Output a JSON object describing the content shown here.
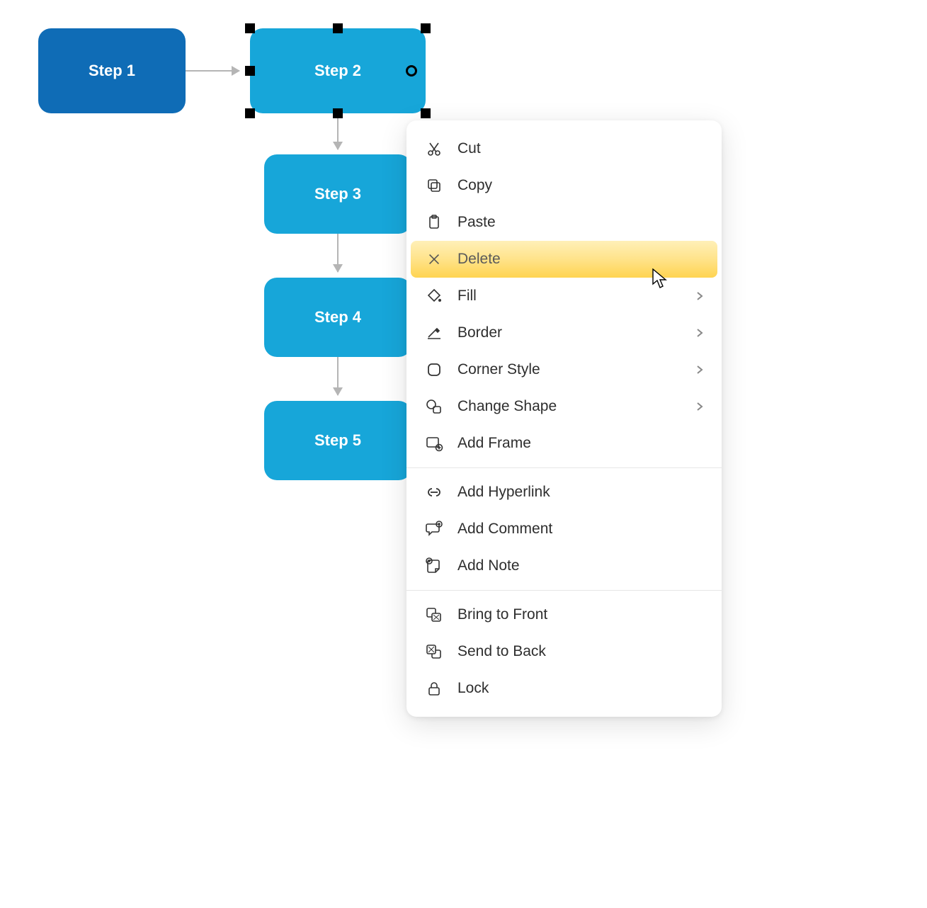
{
  "nodes": {
    "step1": "Step 1",
    "step2": "Step 2",
    "step3": "Step 3",
    "step4": "Step 4",
    "step5": "Step 5"
  },
  "selected_node": "step2",
  "context_menu": {
    "cut": "Cut",
    "copy": "Copy",
    "paste": "Paste",
    "delete": "Delete",
    "fill": "Fill",
    "border": "Border",
    "corner_style": "Corner Style",
    "change_shape": "Change Shape",
    "add_frame": "Add Frame",
    "add_hyperlink": "Add Hyperlink",
    "add_comment": "Add Comment",
    "add_note": "Add Note",
    "bring_to_front": "Bring to Front",
    "send_to_back": "Send to Back",
    "lock": "Lock"
  },
  "highlighted_menu_item": "delete",
  "colors": {
    "node_dark": "#0f6cb6",
    "node_light": "#17a6d9",
    "arrow": "#b5b5b5",
    "highlight_grad_top": "#fff0b8",
    "highlight_grad_bottom": "#ffd451"
  }
}
